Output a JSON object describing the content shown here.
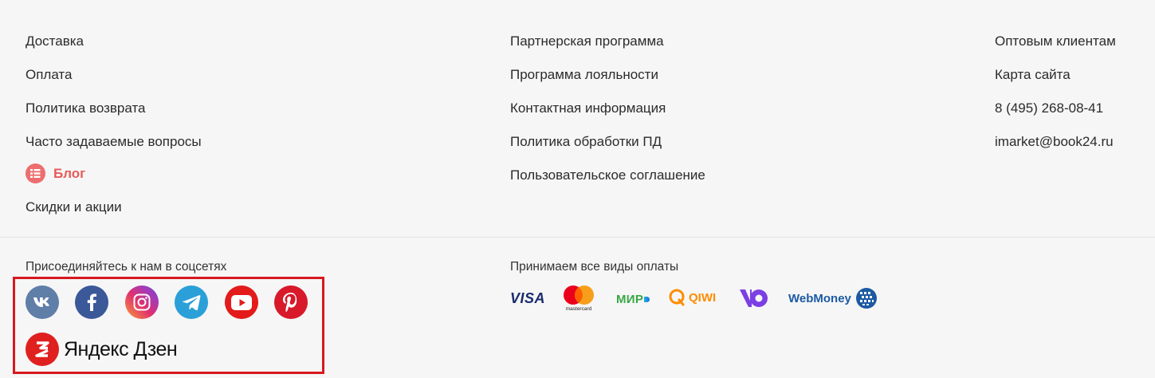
{
  "footer": {
    "col1": [
      "Доставка",
      "Оплата",
      "Политика возврата",
      "Часто задаваемые вопросы",
      "Блог",
      "Скидки и акции"
    ],
    "col2": [
      "Партнерская программа",
      "Программа лояльности",
      "Контактная информация",
      "Политика обработки ПД",
      "Пользовательское соглашение"
    ],
    "col3": [
      "Оптовым клиентам",
      "Карта сайта",
      "8 (495) 268-08-41",
      "imarket@book24.ru"
    ]
  },
  "social": {
    "title": "Присоединяйтесь к нам в соцсетях",
    "items": [
      "vk-icon",
      "facebook-icon",
      "instagram-icon",
      "telegram-icon",
      "youtube-icon",
      "pinterest-icon"
    ],
    "zen_label": "Яндекс Дзен"
  },
  "payment": {
    "title": "Принимаем все виды оплаты",
    "visa": "VISA",
    "mastercard": "mastercard",
    "mir": "МИР",
    "qiwi": "QIWI",
    "webmoney": "WebMoney"
  },
  "colors": {
    "blog": "#e85a5a",
    "vk": "#5f7ea8",
    "facebook": "#3b5998",
    "telegram": "#2ba0d8",
    "youtube": "#e31b1b",
    "pinterest": "#d7192a",
    "zen": "#e0201f",
    "highlight": "#d7191f"
  }
}
